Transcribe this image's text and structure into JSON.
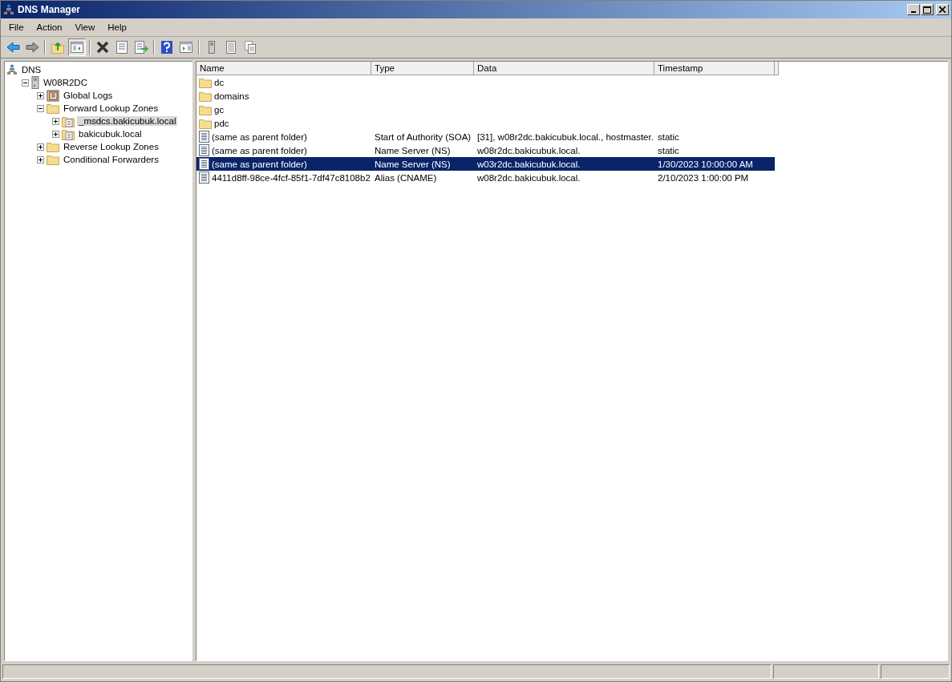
{
  "window": {
    "title": "DNS Manager"
  },
  "menu": [
    "File",
    "Action",
    "View",
    "Help"
  ],
  "toolbar": [
    {
      "kind": "back",
      "pressed": false
    },
    {
      "kind": "forward",
      "pressed": false
    },
    {
      "kind": "sep"
    },
    {
      "kind": "up",
      "pressed": false
    },
    {
      "kind": "tree",
      "pressed": true
    },
    {
      "kind": "sep"
    },
    {
      "kind": "delete",
      "pressed": false
    },
    {
      "kind": "properties",
      "pressed": false
    },
    {
      "kind": "export",
      "pressed": false
    },
    {
      "kind": "sep"
    },
    {
      "kind": "help",
      "pressed": false
    },
    {
      "kind": "pane",
      "pressed": false
    },
    {
      "kind": "sep"
    },
    {
      "kind": "server",
      "pressed": false
    },
    {
      "kind": "list",
      "pressed": false
    },
    {
      "kind": "copy",
      "pressed": false
    }
  ],
  "tree": [
    {
      "label": "DNS",
      "kind": "dns",
      "selected": false,
      "children": [
        {
          "label": "W08R2DC",
          "kind": "server",
          "expanded": true,
          "selected": false,
          "children": [
            {
              "label": "Global Logs",
              "kind": "logs",
              "expanded": false,
              "selected": false
            },
            {
              "label": "Forward Lookup Zones",
              "kind": "folder",
              "expanded": true,
              "selected": false,
              "children": [
                {
                  "label": "_msdcs.bakicubuk.local",
                  "kind": "zone",
                  "expanded": false,
                  "selected": true
                },
                {
                  "label": "bakicubuk.local",
                  "kind": "zone",
                  "expanded": false,
                  "selected": false
                }
              ]
            },
            {
              "label": "Reverse Lookup Zones",
              "kind": "folder",
              "expanded": false,
              "selected": false
            },
            {
              "label": "Conditional Forwarders",
              "kind": "folder",
              "expanded": false,
              "selected": false
            }
          ]
        }
      ]
    }
  ],
  "table": {
    "columns": [
      "Name",
      "Type",
      "Data",
      "Timestamp"
    ],
    "rows": [
      {
        "kind": "folder",
        "selected": false,
        "cells": [
          "dc"
        ]
      },
      {
        "kind": "folder",
        "selected": false,
        "cells": [
          "domains"
        ]
      },
      {
        "kind": "folder",
        "selected": false,
        "cells": [
          "gc"
        ]
      },
      {
        "kind": "folder",
        "selected": false,
        "cells": [
          "pdc"
        ]
      },
      {
        "kind": "record",
        "selected": false,
        "cells": [
          "(same as parent folder)",
          "Start of Authority (SOA)",
          "[31], w08r2dc.bakicubuk.local., hostmaster.",
          "static"
        ]
      },
      {
        "kind": "record",
        "selected": false,
        "cells": [
          "(same as parent folder)",
          "Name Server (NS)",
          "w08r2dc.bakicubuk.local.",
          "static"
        ]
      },
      {
        "kind": "record",
        "selected": true,
        "cells": [
          "(same as parent folder)",
          "Name Server (NS)",
          "w03r2dc.bakicubuk.local.",
          "1/30/2023 10:00:00 AM"
        ]
      },
      {
        "kind": "record",
        "selected": false,
        "cells": [
          "4411d8ff-98ce-4fcf-85f1-7df47c8108b2",
          "Alias (CNAME)",
          "w08r2dc.bakicubuk.local.",
          "2/10/2023 1:00:00 PM"
        ]
      }
    ]
  }
}
